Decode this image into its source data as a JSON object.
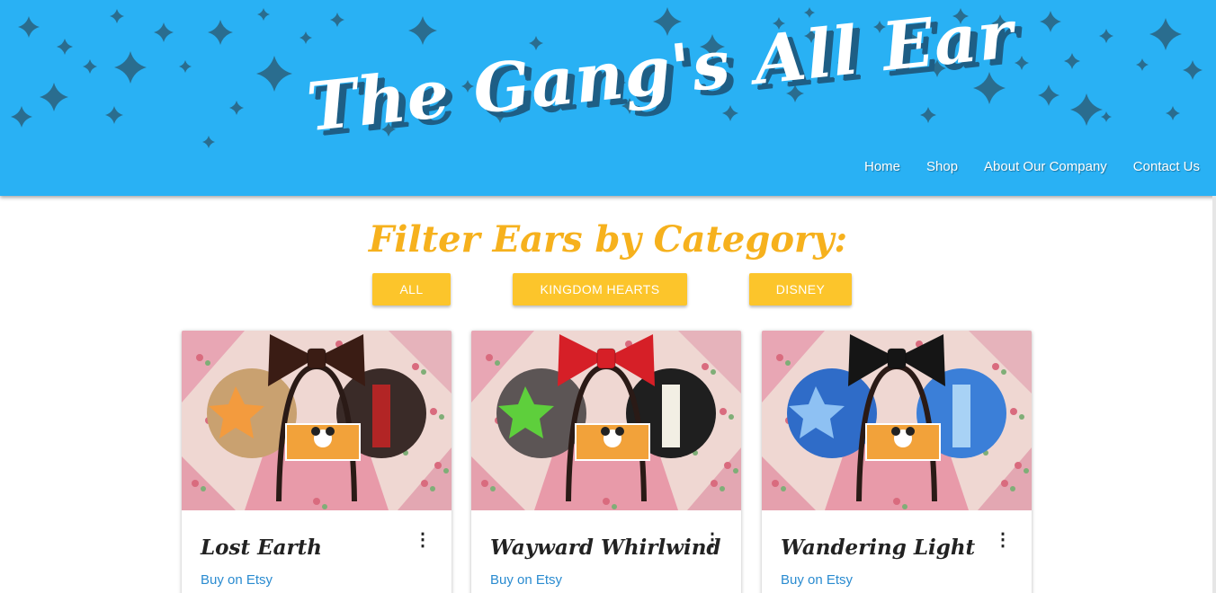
{
  "site": {
    "title": "The Gang's All Ear"
  },
  "nav": {
    "items": [
      "Home",
      "Shop",
      "About Our Company",
      "Contact Us"
    ]
  },
  "filter": {
    "heading": "Filter Ears by Category:",
    "buttons": [
      "ALL",
      "KINGDOM HEARTS",
      "DISNEY"
    ]
  },
  "colors": {
    "header_bg": "#29b1f4",
    "star": "#2a6d8f",
    "accent_yellow": "#fcc52b",
    "heading_orange": "#f6b11d",
    "link_blue": "#2a8bd0"
  },
  "products": [
    {
      "title": "Lost Earth",
      "link": "Buy on Etsy",
      "menu_icon": "more-vert-icon",
      "bow_color": "#3a1c14",
      "left_ear": "#c9a170",
      "right_ear": "#3a2b28",
      "left_accent": "#f39b3e",
      "right_accent": "#b22525"
    },
    {
      "title": "Wayward Whirlwind",
      "link": "Buy on Etsy",
      "menu_icon": "more-vert-icon",
      "bow_color": "#d61f27",
      "left_ear": "#5c5555",
      "right_ear": "#1f1f1f",
      "left_accent": "#5ecf3c",
      "right_accent": "#f2efe4"
    },
    {
      "title": "Wandering Light",
      "link": "Buy on Etsy",
      "menu_icon": "more-vert-icon",
      "bow_color": "#151515",
      "left_ear": "#2f6cc8",
      "right_ear": "#3b7fd8",
      "left_accent": "#8ec1f3",
      "right_accent": "#a8d2f5"
    }
  ]
}
